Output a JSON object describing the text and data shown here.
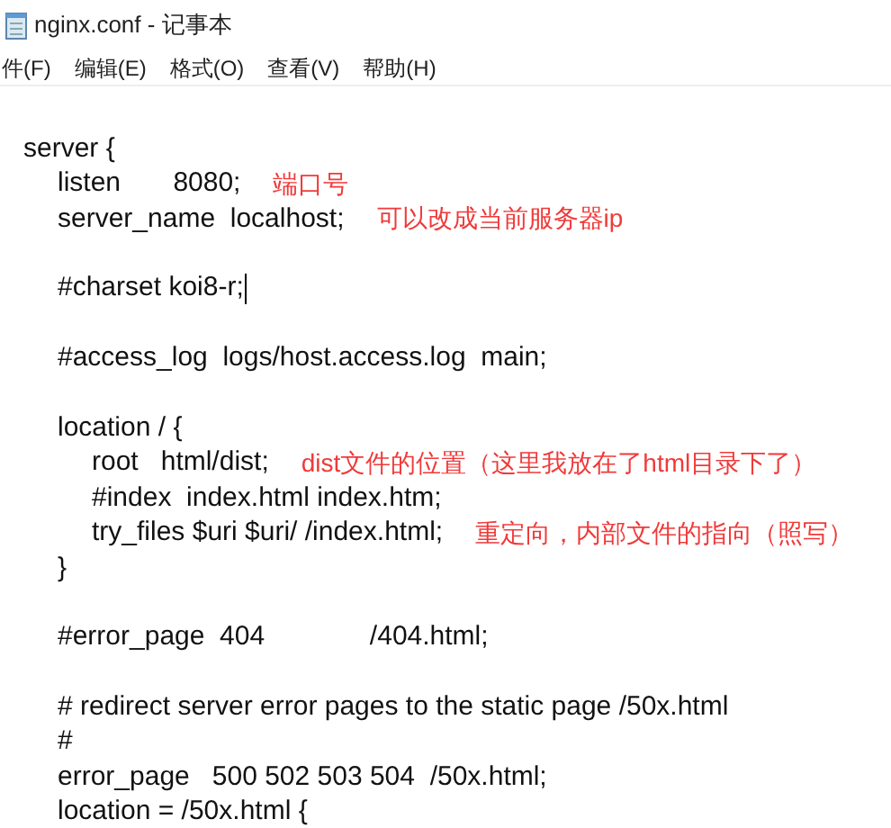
{
  "window": {
    "title": "nginx.conf - 记事本"
  },
  "menu": [
    "件(F)",
    "编辑(E)",
    "格式(O)",
    "查看(V)",
    "帮助(H)"
  ],
  "editor": {
    "lines": [
      {
        "kind": "blank"
      },
      {
        "kind": "code",
        "text": "server {",
        "children": [
          {
            "kind": "code",
            "text": "listen       8080;",
            "note": "端口号"
          },
          {
            "kind": "code",
            "text": "server_name  localhost;",
            "note": "可以改成当前服务器ip"
          },
          {
            "kind": "blank"
          },
          {
            "kind": "code",
            "text": "#charset koi8-r;",
            "cursor": true
          },
          {
            "kind": "blank"
          },
          {
            "kind": "code",
            "text": "#access_log  logs/host.access.log  main;"
          },
          {
            "kind": "blank"
          },
          {
            "kind": "code",
            "text": "location / {",
            "children": [
              {
                "kind": "code",
                "text": "root   html/dist;",
                "note": "dist文件的位置（这里我放在了html目录下了）"
              },
              {
                "kind": "code",
                "text": "#index  index.html index.htm;"
              },
              {
                "kind": "code",
                "text": "try_files $uri $uri/ /index.html;",
                "note": "重定向，内部文件的指向（照写）"
              }
            ]
          },
          {
            "kind": "code",
            "text": "}"
          },
          {
            "kind": "blank"
          },
          {
            "kind": "code",
            "text": "#error_page  404              /404.html;"
          },
          {
            "kind": "blank"
          },
          {
            "kind": "code",
            "text": "# redirect server error pages to the static page /50x.html"
          },
          {
            "kind": "code",
            "text": "#"
          },
          {
            "kind": "code",
            "text": "error_page   500 502 503 504  /50x.html;"
          },
          {
            "kind": "code",
            "text": "location = /50x.html {"
          }
        ]
      }
    ]
  }
}
